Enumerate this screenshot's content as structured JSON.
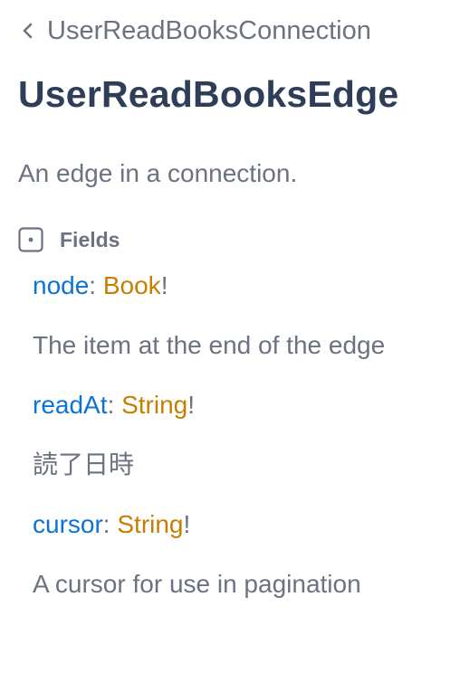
{
  "breadcrumb": {
    "label": "UserReadBooksConnection",
    "icon": "chevron-left-icon"
  },
  "page": {
    "title": "UserReadBooksEdge",
    "description": "An edge in a connection."
  },
  "fields_section": {
    "label": "Fields",
    "icon": "field-box-icon"
  },
  "fields": [
    {
      "name": "node",
      "colon": ":",
      "type": "Book",
      "nonnull": "!",
      "description": "The item at the end of the edge"
    },
    {
      "name": "readAt",
      "colon": ":",
      "type": "String",
      "nonnull": "!",
      "description": "読了日時"
    },
    {
      "name": "cursor",
      "colon": ":",
      "type": "String",
      "nonnull": "!",
      "description": "A cursor for use in pagination"
    }
  ],
  "colors": {
    "title": "#2f3e58",
    "text": "#6b7280",
    "field_name": "#0b73d6",
    "field_type": "#c67f00"
  }
}
